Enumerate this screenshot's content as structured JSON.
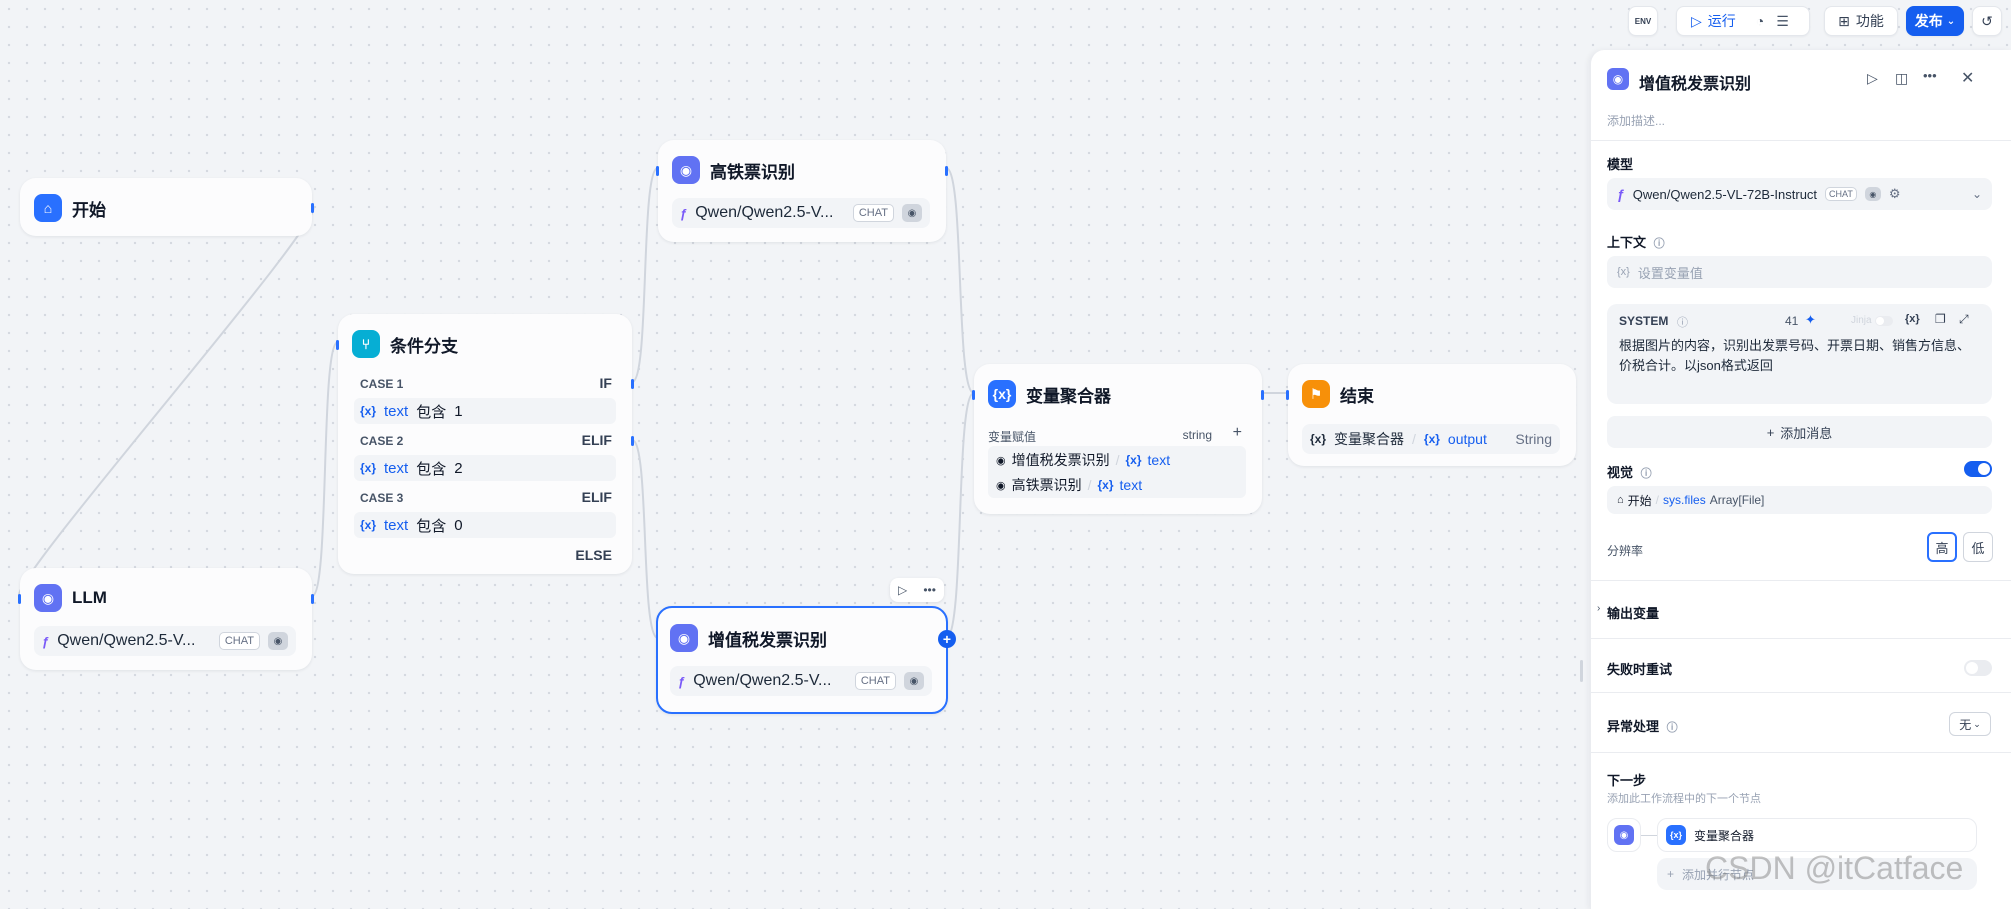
{
  "toolbar": {
    "env_label": "ENV",
    "run_label": "运行",
    "features_label": "功能",
    "publish_label": "发布"
  },
  "nodes": {
    "start": {
      "title": "开始"
    },
    "llm": {
      "title": "LLM",
      "model": "Qwen/Qwen2.5-V...",
      "chip": "CHAT"
    },
    "rail": {
      "title": "高铁票识别",
      "model": "Qwen/Qwen2.5-V...",
      "chip": "CHAT"
    },
    "branch": {
      "title": "条件分支",
      "cases": [
        {
          "label": "CASE 1",
          "kind": "IF",
          "var": "text",
          "op": "包含",
          "value": "1"
        },
        {
          "label": "CASE 2",
          "kind": "ELIF",
          "var": "text",
          "op": "包含",
          "value": "2"
        },
        {
          "label": "CASE 3",
          "kind": "ELIF",
          "var": "text",
          "op": "包含",
          "value": "0"
        }
      ],
      "else_label": "ELSE"
    },
    "vat": {
      "title": "增值税发票识别",
      "model": "Qwen/Qwen2.5-V...",
      "chip": "CHAT"
    },
    "aggregator": {
      "title": "变量聚合器",
      "var_label": "变量赋值",
      "type": "string",
      "items": [
        {
          "node": "增值税发票识别",
          "var": "text"
        },
        {
          "node": "高铁票识别",
          "var": "text"
        }
      ]
    },
    "end": {
      "title": "结束",
      "var_node": "变量聚合器",
      "var": "output",
      "type": "String"
    }
  },
  "panel": {
    "title": "增值税发票识别",
    "description_placeholder": "添加描述...",
    "model_label": "模型",
    "model_name": "Qwen/Qwen2.5-VL-72B-Instruct",
    "model_chip": "CHAT",
    "context_label": "上下文",
    "context_placeholder": "设置变量值",
    "system_label": "SYSTEM",
    "system_count": "41",
    "jinja_label": "Jinja",
    "system_prompt": "根据图片的内容，识别出发票号码、开票日期、销售方信息、价税合计。以json格式返回",
    "add_message": "添加消息",
    "vision_label": "视觉",
    "vision_source": "开始",
    "vision_var": "sys.files",
    "vision_type": "Array[File]",
    "resolution_label": "分辨率",
    "resolution_high": "高",
    "resolution_low": "低",
    "output_vars_label": "输出变量",
    "retry_label": "失败时重试",
    "error_label": "异常处理",
    "error_value": "无",
    "next_step_label": "下一步",
    "next_step_hint": "添加此工作流程中的下一个节点",
    "next_node": "变量聚合器",
    "add_parallel": "添加并行节点",
    "watermark": "CSDN @itCatface"
  },
  "colors": {
    "accent": "#155eef",
    "start_icon": "#2970ff",
    "llm_icon": "#6172f3",
    "branch_icon": "#06aed4",
    "end_icon": "#f79009"
  }
}
